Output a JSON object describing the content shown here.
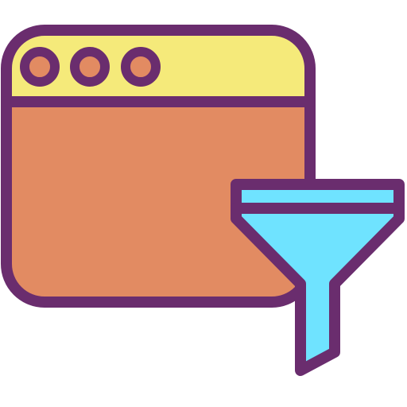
{
  "icon": {
    "name": "browser-window-filter-icon",
    "parts": [
      "browser-window-icon",
      "funnel-icon"
    ]
  },
  "colors": {
    "outline": "#6a2d6e",
    "title_bar": "#f5ea7a",
    "window_body": "#e28b62",
    "dots_fill": "#e28b62",
    "funnel_fill": "#6fe3ff",
    "background": "#ffffff"
  }
}
